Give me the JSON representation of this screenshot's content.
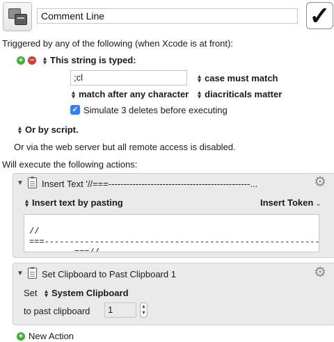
{
  "macro": {
    "name": "Comment Line",
    "enabled_checkmark": "✓"
  },
  "trigger": {
    "heading": "Triggered by any of the following (when Xcode is at front):",
    "add_icon": "plus-icon",
    "remove_icon": "minus-icon",
    "type_label": "This string is typed:",
    "typed_string": ";cl",
    "case_option": "case must match",
    "match_option": "match after any character",
    "diacritics_option": "diacriticals matter",
    "simulate_label": "Simulate 3 deletes before executing",
    "simulate_checked": true,
    "script_label": "Or by script.",
    "web_server_text": "Or via the web server but all remote access is disabled."
  },
  "actions_heading": "Will execute the following actions:",
  "actions": [
    {
      "title": "Insert Text '//===-----------------------------------------------...",
      "method_label": "Insert text by pasting",
      "token_label": "Insert Token",
      "text_lines": [
        "//",
        "===-------------------------------------------------------------",
        "---------===//"
      ]
    },
    {
      "title": "Set Clipboard to Past Clipboard 1",
      "set_label": "Set",
      "clipboard_label": "System Clipboard",
      "past_label": "to past clipboard",
      "past_value": "1"
    }
  ],
  "new_action_label": "New Action",
  "colors": {
    "add": "#3fae3b",
    "remove": "#d93a35",
    "checkbox": "#2f7ff7"
  }
}
